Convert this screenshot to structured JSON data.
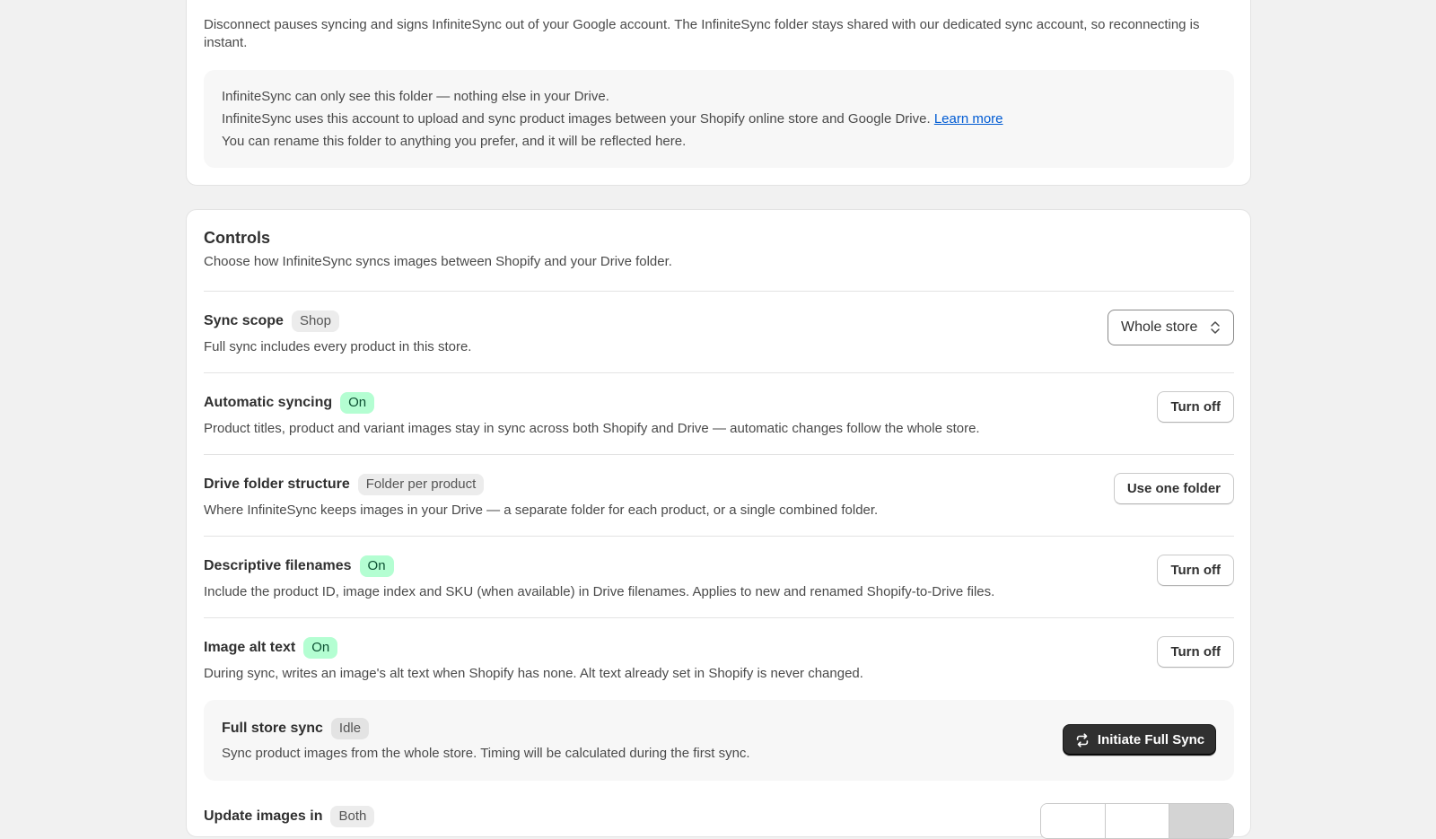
{
  "top_card": {
    "description": "Disconnect pauses syncing and signs InfiniteSync out of your Google account. The InfiniteSync folder stays shared with our dedicated sync account, so reconnecting is instant.",
    "info_lines": [
      "InfiniteSync can only see this folder — nothing else in your Drive.",
      "InfiniteSync uses this account to upload and sync product images between your Shopify online store and Google Drive.",
      "You can rename this folder to anything you prefer, and it will be reflected here."
    ],
    "learn_more": "Learn more"
  },
  "controls": {
    "title": "Controls",
    "subtitle": "Choose how InfiniteSync syncs images between Shopify and your Drive folder.",
    "sync_scope": {
      "title": "Sync scope",
      "badge": "Shop",
      "description": "Full sync includes every product in this store.",
      "select_value": "Whole store"
    },
    "automatic_syncing": {
      "title": "Automatic syncing",
      "badge": "On",
      "description": "Product titles, product and variant images stay in sync across both Shopify and Drive — automatic changes follow the whole store.",
      "button": "Turn off"
    },
    "drive_folder_structure": {
      "title": "Drive folder structure",
      "badge": "Folder per product",
      "description": "Where InfiniteSync keeps images in your Drive — a separate folder for each product, or a single combined folder.",
      "button": "Use one folder"
    },
    "descriptive_filenames": {
      "title": "Descriptive filenames",
      "badge": "On",
      "description": "Include the product ID, image index and SKU (when available) in Drive filenames. Applies to new and renamed Shopify-to-Drive files.",
      "button": "Turn off"
    },
    "image_alt_text": {
      "title": "Image alt text",
      "badge": "On",
      "description": "During sync, writes an image's alt text when Shopify has none. Alt text already set in Shopify is never changed.",
      "button": "Turn off"
    },
    "full_store_sync": {
      "title": "Full store sync",
      "badge": "Idle",
      "description": "Sync product images from the whole store. Timing will be calculated during the first sync.",
      "button": "Initiate Full Sync"
    },
    "update_images_in": {
      "title": "Update images in",
      "badge": "Both"
    }
  },
  "colors": {
    "background": "#f1f1f1",
    "card": "#ffffff",
    "badge_on": "#b4fed2",
    "primary_button": "#303030",
    "link": "#005bd3"
  }
}
